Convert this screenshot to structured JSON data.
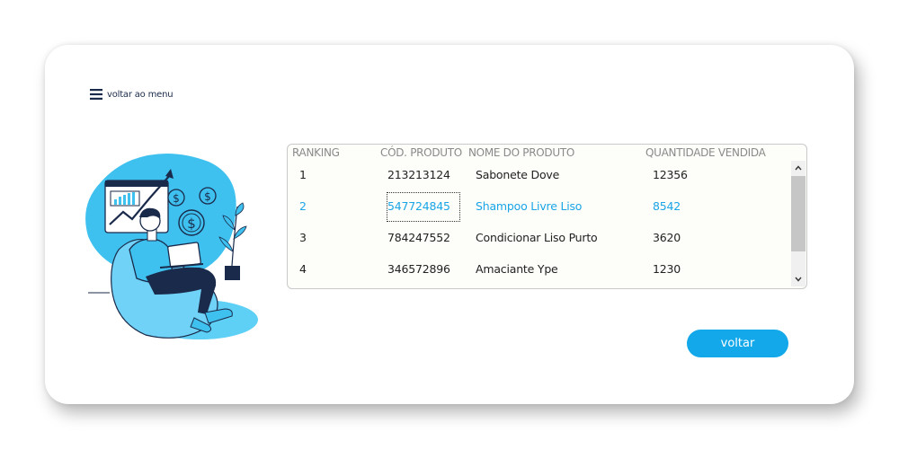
{
  "nav": {
    "menu_label": "voltar ao menu"
  },
  "table": {
    "columns": [
      "RANKING",
      "CÓD. PRODUTO",
      "NOME DO PRODUTO",
      "QUANTIDADE VENDIDA"
    ],
    "rows": [
      {
        "ranking": "1",
        "codigo": "213213124",
        "nome": "Sabonete  Dove",
        "quantidade": "12356"
      },
      {
        "ranking": "2",
        "codigo": "547724845",
        "nome": "Shampoo Livre Liso",
        "quantidade": "8542"
      },
      {
        "ranking": "3",
        "codigo": "784247552",
        "nome": "Condicionar Liso Purto",
        "quantidade": "3620"
      },
      {
        "ranking": "4",
        "codigo": "346572896",
        "nome": "Amaciante Ype",
        "quantidade": "1230"
      }
    ],
    "selected_row": 2
  },
  "actions": {
    "back_label": "voltar"
  },
  "colors": {
    "accent": "#13a8ea",
    "navy": "#1a2a4a",
    "illustration_blue": "#3fc1f0"
  },
  "icons": [
    "hamburger-menu-icon",
    "dollar-coin-icon",
    "chevron-up-icon",
    "chevron-down-icon"
  ]
}
